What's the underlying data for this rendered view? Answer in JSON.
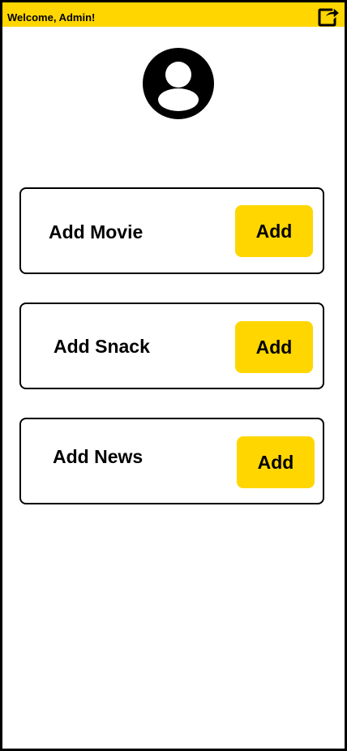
{
  "header": {
    "welcome_text": "Welcome, Admin!",
    "logout_icon": "share-exit-icon",
    "background_color": "#FFD600"
  },
  "profile": {
    "avatar_icon": "user-avatar-icon"
  },
  "cards": [
    {
      "label": "Add Movie",
      "button_label": "Add"
    },
    {
      "label": "Add Snack",
      "button_label": "Add"
    },
    {
      "label": "Add News",
      "button_label": "Add"
    }
  ],
  "colors": {
    "accent": "#FFD600",
    "text": "#000000",
    "border": "#000000",
    "background": "#FFFFFF"
  }
}
